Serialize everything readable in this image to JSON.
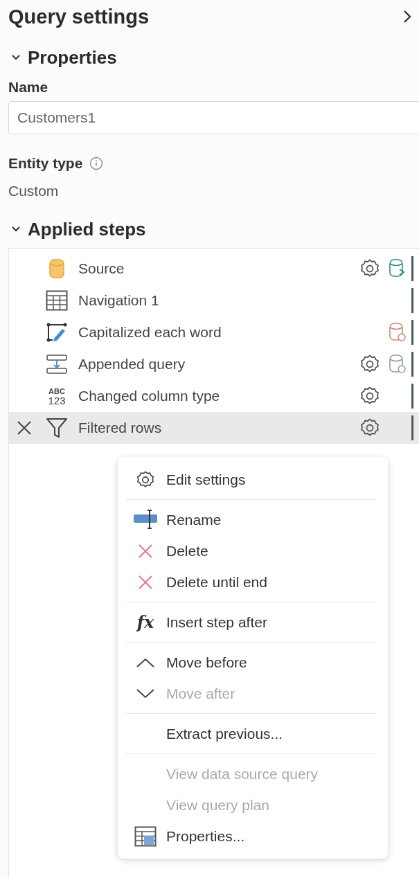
{
  "panel": {
    "title": "Query settings"
  },
  "properties": {
    "heading": "Properties",
    "expanded": true,
    "name_label": "Name",
    "name_value": "Customers1",
    "entity_label": "Entity type",
    "entity_value": "Custom"
  },
  "applied_steps": {
    "heading": "Applied steps",
    "expanded": true,
    "steps": [
      {
        "label": "Source",
        "kind": "database",
        "selected": false,
        "settings": true,
        "indicator": {
          "kind": "linked",
          "color": "#2a8a8a"
        }
      },
      {
        "label": "Navigation 1",
        "kind": "table",
        "selected": false,
        "settings": false
      },
      {
        "label": "Capitalized each word",
        "kind": "transform",
        "selected": false,
        "settings": false,
        "indicator": {
          "kind": "eye",
          "color": "#c98a70"
        }
      },
      {
        "label": "Appended query",
        "kind": "append",
        "selected": false,
        "settings": true,
        "indicator": {
          "kind": "eye",
          "color": "#999999"
        }
      },
      {
        "label": "Changed column type",
        "kind": "type",
        "icon_text": [
          "ABC",
          "123"
        ],
        "selected": false,
        "settings": true
      },
      {
        "label": "Filtered rows",
        "kind": "filter",
        "selected": true,
        "settings": true
      }
    ]
  },
  "context_menu": [
    {
      "kind": "settings",
      "label": "Edit settings",
      "disabled": false
    },
    {
      "kind": "separator"
    },
    {
      "kind": "rename",
      "label": "Rename",
      "disabled": false
    },
    {
      "kind": "delete",
      "label": "Delete",
      "disabled": false
    },
    {
      "kind": "delete",
      "label": "Delete until end",
      "disabled": false
    },
    {
      "kind": "separator"
    },
    {
      "kind": "fx",
      "label": "Insert step after",
      "icon_text": "fx",
      "disabled": false
    },
    {
      "kind": "separator"
    },
    {
      "kind": "move-up",
      "label": "Move before",
      "disabled": false
    },
    {
      "kind": "move-down",
      "label": "Move after",
      "disabled": true
    },
    {
      "kind": "separator"
    },
    {
      "kind": "plain",
      "label": "Extract previous...",
      "disabled": false
    },
    {
      "kind": "separator"
    },
    {
      "kind": "plain",
      "label": "View data source query",
      "disabled": true
    },
    {
      "kind": "plain",
      "label": "View query plan",
      "disabled": true
    },
    {
      "kind": "properties",
      "label": "Properties...",
      "disabled": false
    }
  ]
}
